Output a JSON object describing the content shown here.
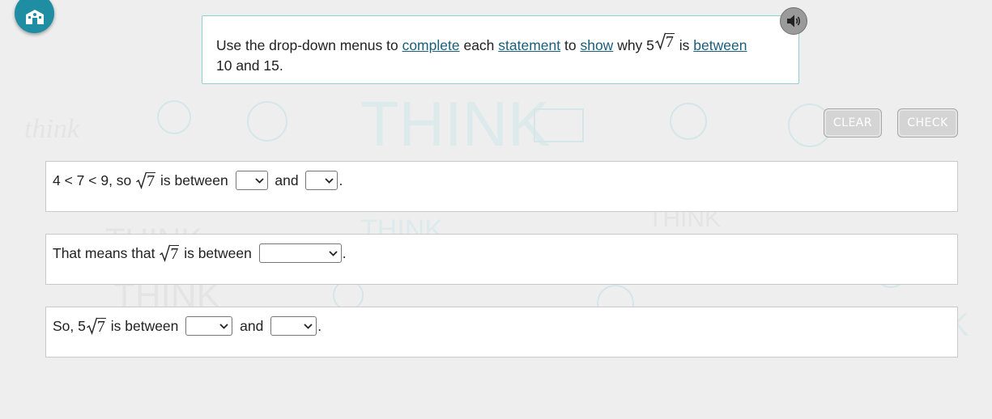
{
  "logo": {
    "icon": "school-building-icon"
  },
  "instructions": {
    "t1": "Use the drop-down menus to ",
    "link1": "complete",
    "t2": " each ",
    "link2": "statement",
    "t3": " to ",
    "link3": "show",
    "t4": " why 5",
    "radicand": "7",
    "t5": " is ",
    "link4": "between",
    "t6": "10 and 15."
  },
  "speaker": {
    "icon": "speaker-icon"
  },
  "buttons": {
    "clear": "CLEAR",
    "check": "CHECK"
  },
  "statements": [
    {
      "prefix": "4 < 7 < 9, so ",
      "radicand": "7",
      "mid": " is between ",
      "dd1_value": "",
      "and": " and ",
      "dd2_value": "",
      "end": "."
    },
    {
      "prefix": "That means that ",
      "radicand": "7",
      "mid": " is between ",
      "dd1_value": "",
      "end": "."
    },
    {
      "prefix": "So, 5",
      "radicand": "7",
      "mid": " is between ",
      "dd1_value": "",
      "and": " and ",
      "dd2_value": "",
      "end": "."
    }
  ],
  "colors": {
    "accent": "#1f8ea3",
    "panel_border": "#8fd0d4",
    "link": "#1a5e7a",
    "button": "#d4d4d4"
  }
}
